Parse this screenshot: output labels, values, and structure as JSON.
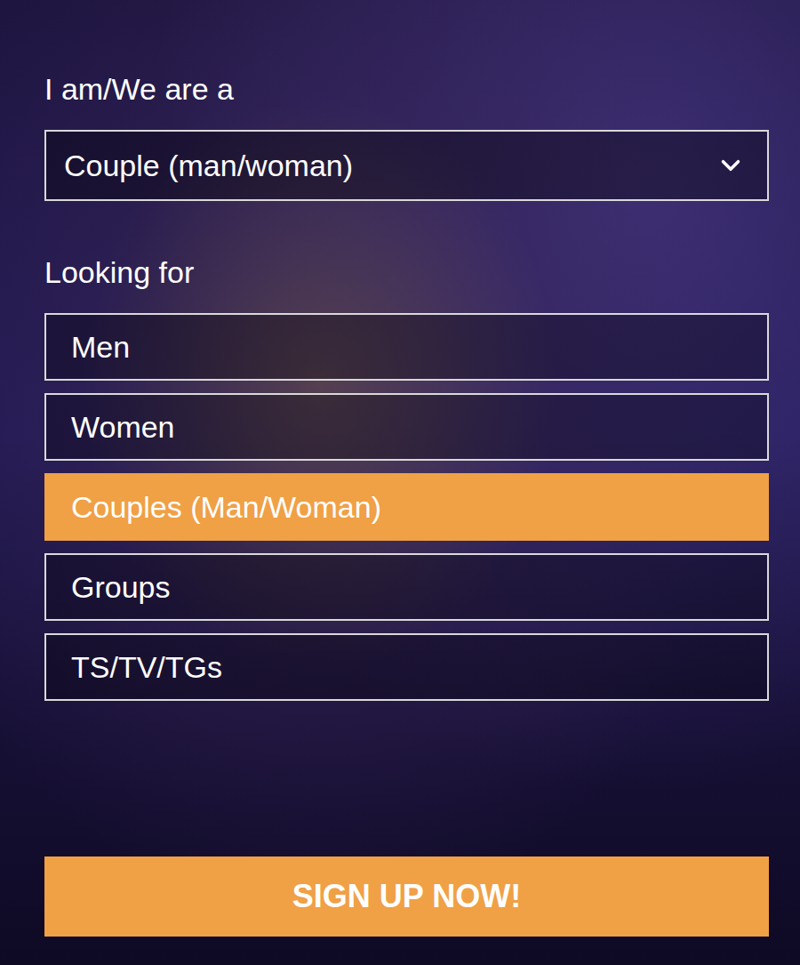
{
  "form": {
    "identity_label": "I am/We are a",
    "identity_value": "Couple (man/woman)",
    "looking_label": "Looking for",
    "options": [
      {
        "label": "Men",
        "selected": false
      },
      {
        "label": "Women",
        "selected": false
      },
      {
        "label": "Couples (Man/Woman)",
        "selected": true
      },
      {
        "label": "Groups",
        "selected": false
      },
      {
        "label": "TS/TV/TGs",
        "selected": false
      }
    ],
    "submit": "SIGN UP NOW!"
  }
}
